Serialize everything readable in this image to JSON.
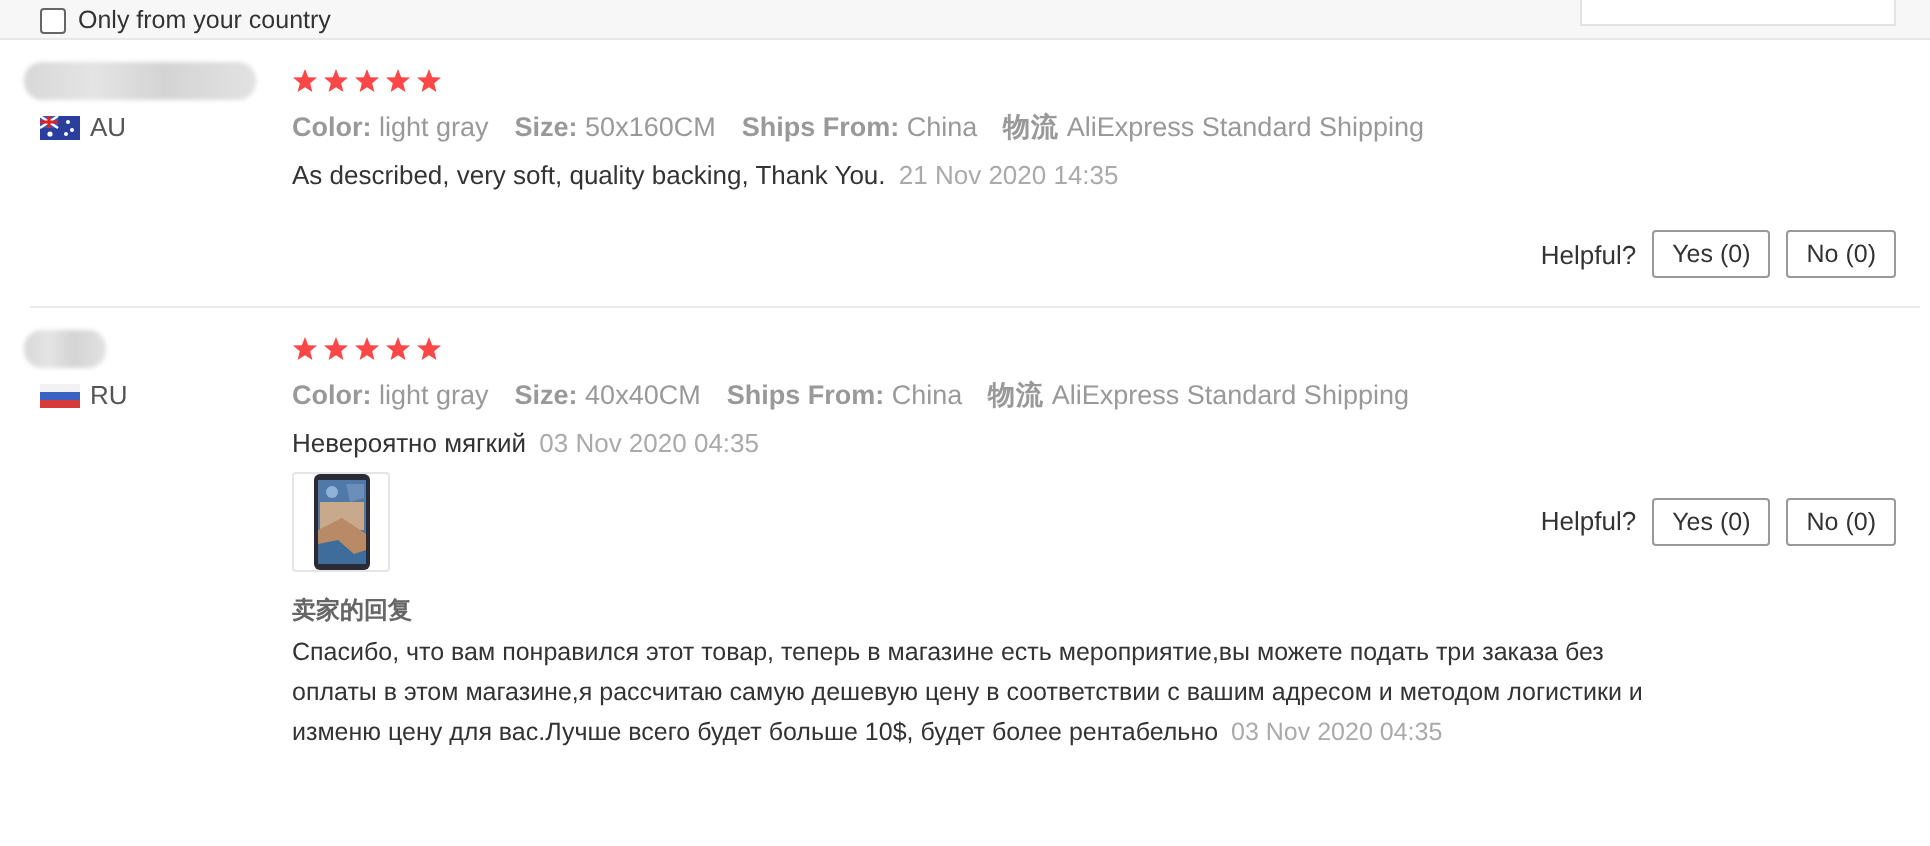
{
  "filter": {
    "label": "Only from your country",
    "checked": false
  },
  "reviews": [
    {
      "kind": "australia",
      "country": "AU",
      "stars": 5,
      "attributes": [
        {
          "label": "Color:",
          "value": "light gray"
        },
        {
          "label": "Size:",
          "value": "50x160CM"
        },
        {
          "label": "Ships From:",
          "value": "China"
        },
        {
          "label": "物流",
          "value": "AliExpress Standard Shipping"
        }
      ],
      "text": "As described, very soft, quality backing, Thank You.",
      "date": "21 Nov 2020 14:35",
      "helpful_label": "Helpful?",
      "buttons": [
        "Yes (0)",
        "No (0)"
      ]
    },
    {
      "kind": "russia",
      "country": "RU",
      "stars": 5,
      "attributes": [
        {
          "label": "Color:",
          "value": "light gray"
        },
        {
          "label": "Size:",
          "value": "40x40CM"
        },
        {
          "label": "Ships From:",
          "value": "China"
        },
        {
          "label": "物流",
          "value": "AliExpress Standard Shipping"
        }
      ],
      "text": "Невероятно мягкий",
      "date": "03 Nov 2020 04:35",
      "photos": [
        {
          "kind": "picture"
        }
      ],
      "helpful_label": "Helpful?",
      "buttons": [
        "Yes (0)",
        "No (0)"
      ],
      "seller_reply": {
        "label": "卖家的回复",
        "text": "Спасибо, что вам понравился этот товар, теперь в магазине есть мероприятие,вы можете подать три заказа без оплаты в этом магазине,я рассчитаю самую дешевую цену в соответствии с вашим адресом и методом логистики и изменю цену для вас.Лучше всего будет больше 10$, будет более рентабельно",
        "date": "03 Nov 2020 04:35"
      }
    }
  ]
}
